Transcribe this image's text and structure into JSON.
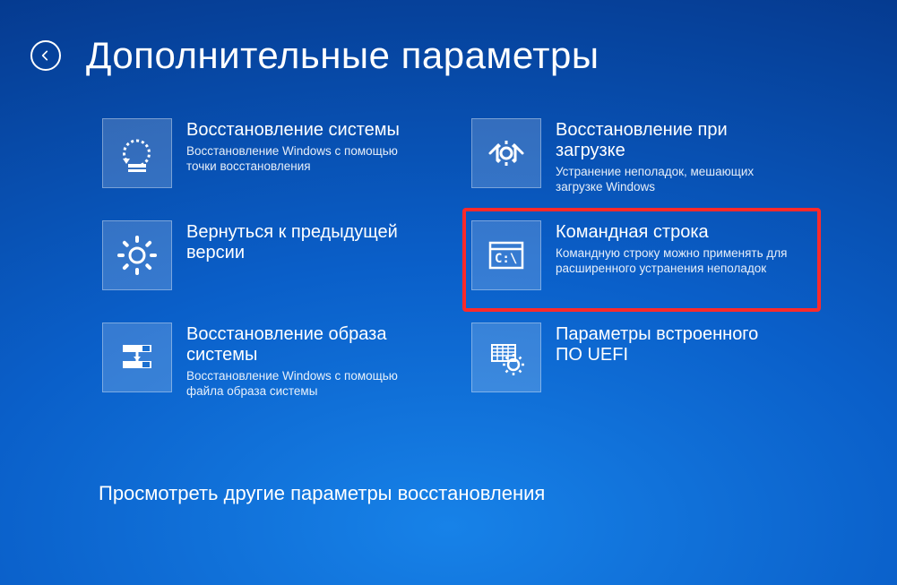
{
  "header": {
    "title": "Дополнительные параметры"
  },
  "tiles": [
    {
      "id": "system-restore",
      "icon": "system-restore-icon",
      "title": "Восстановление системы",
      "desc": "Восстановление Windows с помощью точки восстановления",
      "highlighted": false
    },
    {
      "id": "startup-repair",
      "icon": "startup-repair-icon",
      "title": "Восстановление при загрузке",
      "desc": "Устранение неполадок, мешающих загрузке Windows",
      "highlighted": false
    },
    {
      "id": "go-back",
      "icon": "gear-icon",
      "title": "Вернуться к предыдущей версии",
      "desc": "",
      "highlighted": false
    },
    {
      "id": "command-prompt",
      "icon": "cmd-icon",
      "title": "Командная строка",
      "desc": "Командную строку можно применять для расширенного устранения неполадок",
      "highlighted": true
    },
    {
      "id": "image-recovery",
      "icon": "image-recovery-icon",
      "title": "Восстановление образа системы",
      "desc": "Восстановление Windows с помощью файла образа системы",
      "highlighted": false
    },
    {
      "id": "uefi",
      "icon": "uefi-icon",
      "title": "Параметры встроенного ПО UEFI",
      "desc": "",
      "highlighted": false
    }
  ],
  "footer": {
    "more": "Просмотреть другие параметры восстановления"
  }
}
